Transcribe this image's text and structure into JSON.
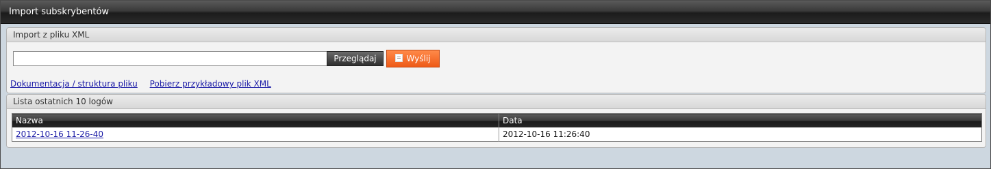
{
  "window": {
    "title": "Import subskrybentów"
  },
  "import_panel": {
    "title": "Import z pliku XML",
    "file_input_value": "",
    "browse_label": "Przeglądaj",
    "send_label": "Wyślij",
    "doc_link": "Dokumentacja / struktura pliku",
    "sample_link": "Pobierz przykładowy plik XML"
  },
  "logs_panel": {
    "title": "Lista ostatnich 10 logów",
    "columns": [
      "Nazwa",
      "Data"
    ],
    "rows": [
      {
        "name": "2012-10-16 11-26-40",
        "date": "2012-10-16 11:26:40"
      }
    ]
  },
  "colors": {
    "accent_orange": "#f06a25",
    "link_blue": "#1a1aa6",
    "titlebar_dark": "#2a2a2a"
  }
}
